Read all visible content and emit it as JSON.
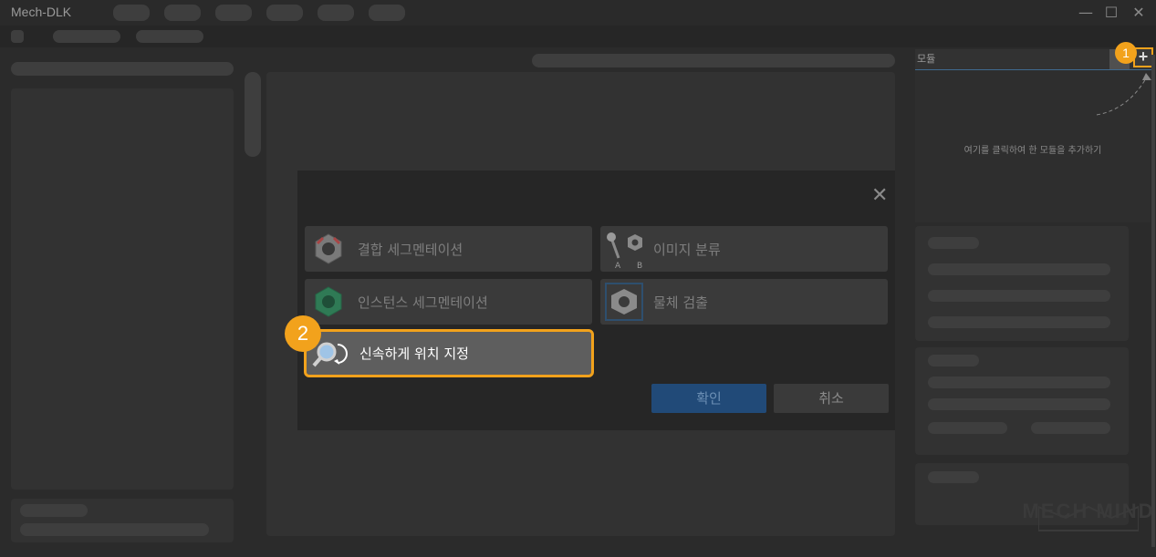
{
  "window": {
    "title": "Mech-DLK"
  },
  "window_controls": {
    "minimize": "—",
    "maximize": "☐",
    "close": "✕"
  },
  "dialog": {
    "close_glyph": "✕",
    "options": [
      {
        "label": "결합 세그멘테이션",
        "icon": "fused-segmentation-nut-icon",
        "selected": false
      },
      {
        "label": "이미지 분류",
        "icon": "image-classification-icon",
        "icon_caption_a": "A",
        "icon_caption_b": "B",
        "selected": false
      },
      {
        "label": "인스턴스 세그멘테이션",
        "icon": "instance-segmentation-nut-icon",
        "selected": false
      },
      {
        "label": "물체 검출",
        "icon": "object-detection-nut-icon",
        "selected": false
      },
      {
        "label": "신속하게 위치 지정",
        "icon": "fast-positioning-magnifier-icon",
        "selected": true
      }
    ],
    "confirm_label": "확인",
    "cancel_label": "취소"
  },
  "modules": {
    "header_label": "모듈",
    "add_glyph": "+",
    "hint": "여기를 클릭하여 한 모듈을 추가하기"
  },
  "callouts": {
    "step1": "1",
    "step2": "2"
  },
  "watermark": "MECH MIND",
  "colors": {
    "accent": "#f2a21c",
    "confirm": "#214a78",
    "background": "#2b2b2b"
  }
}
